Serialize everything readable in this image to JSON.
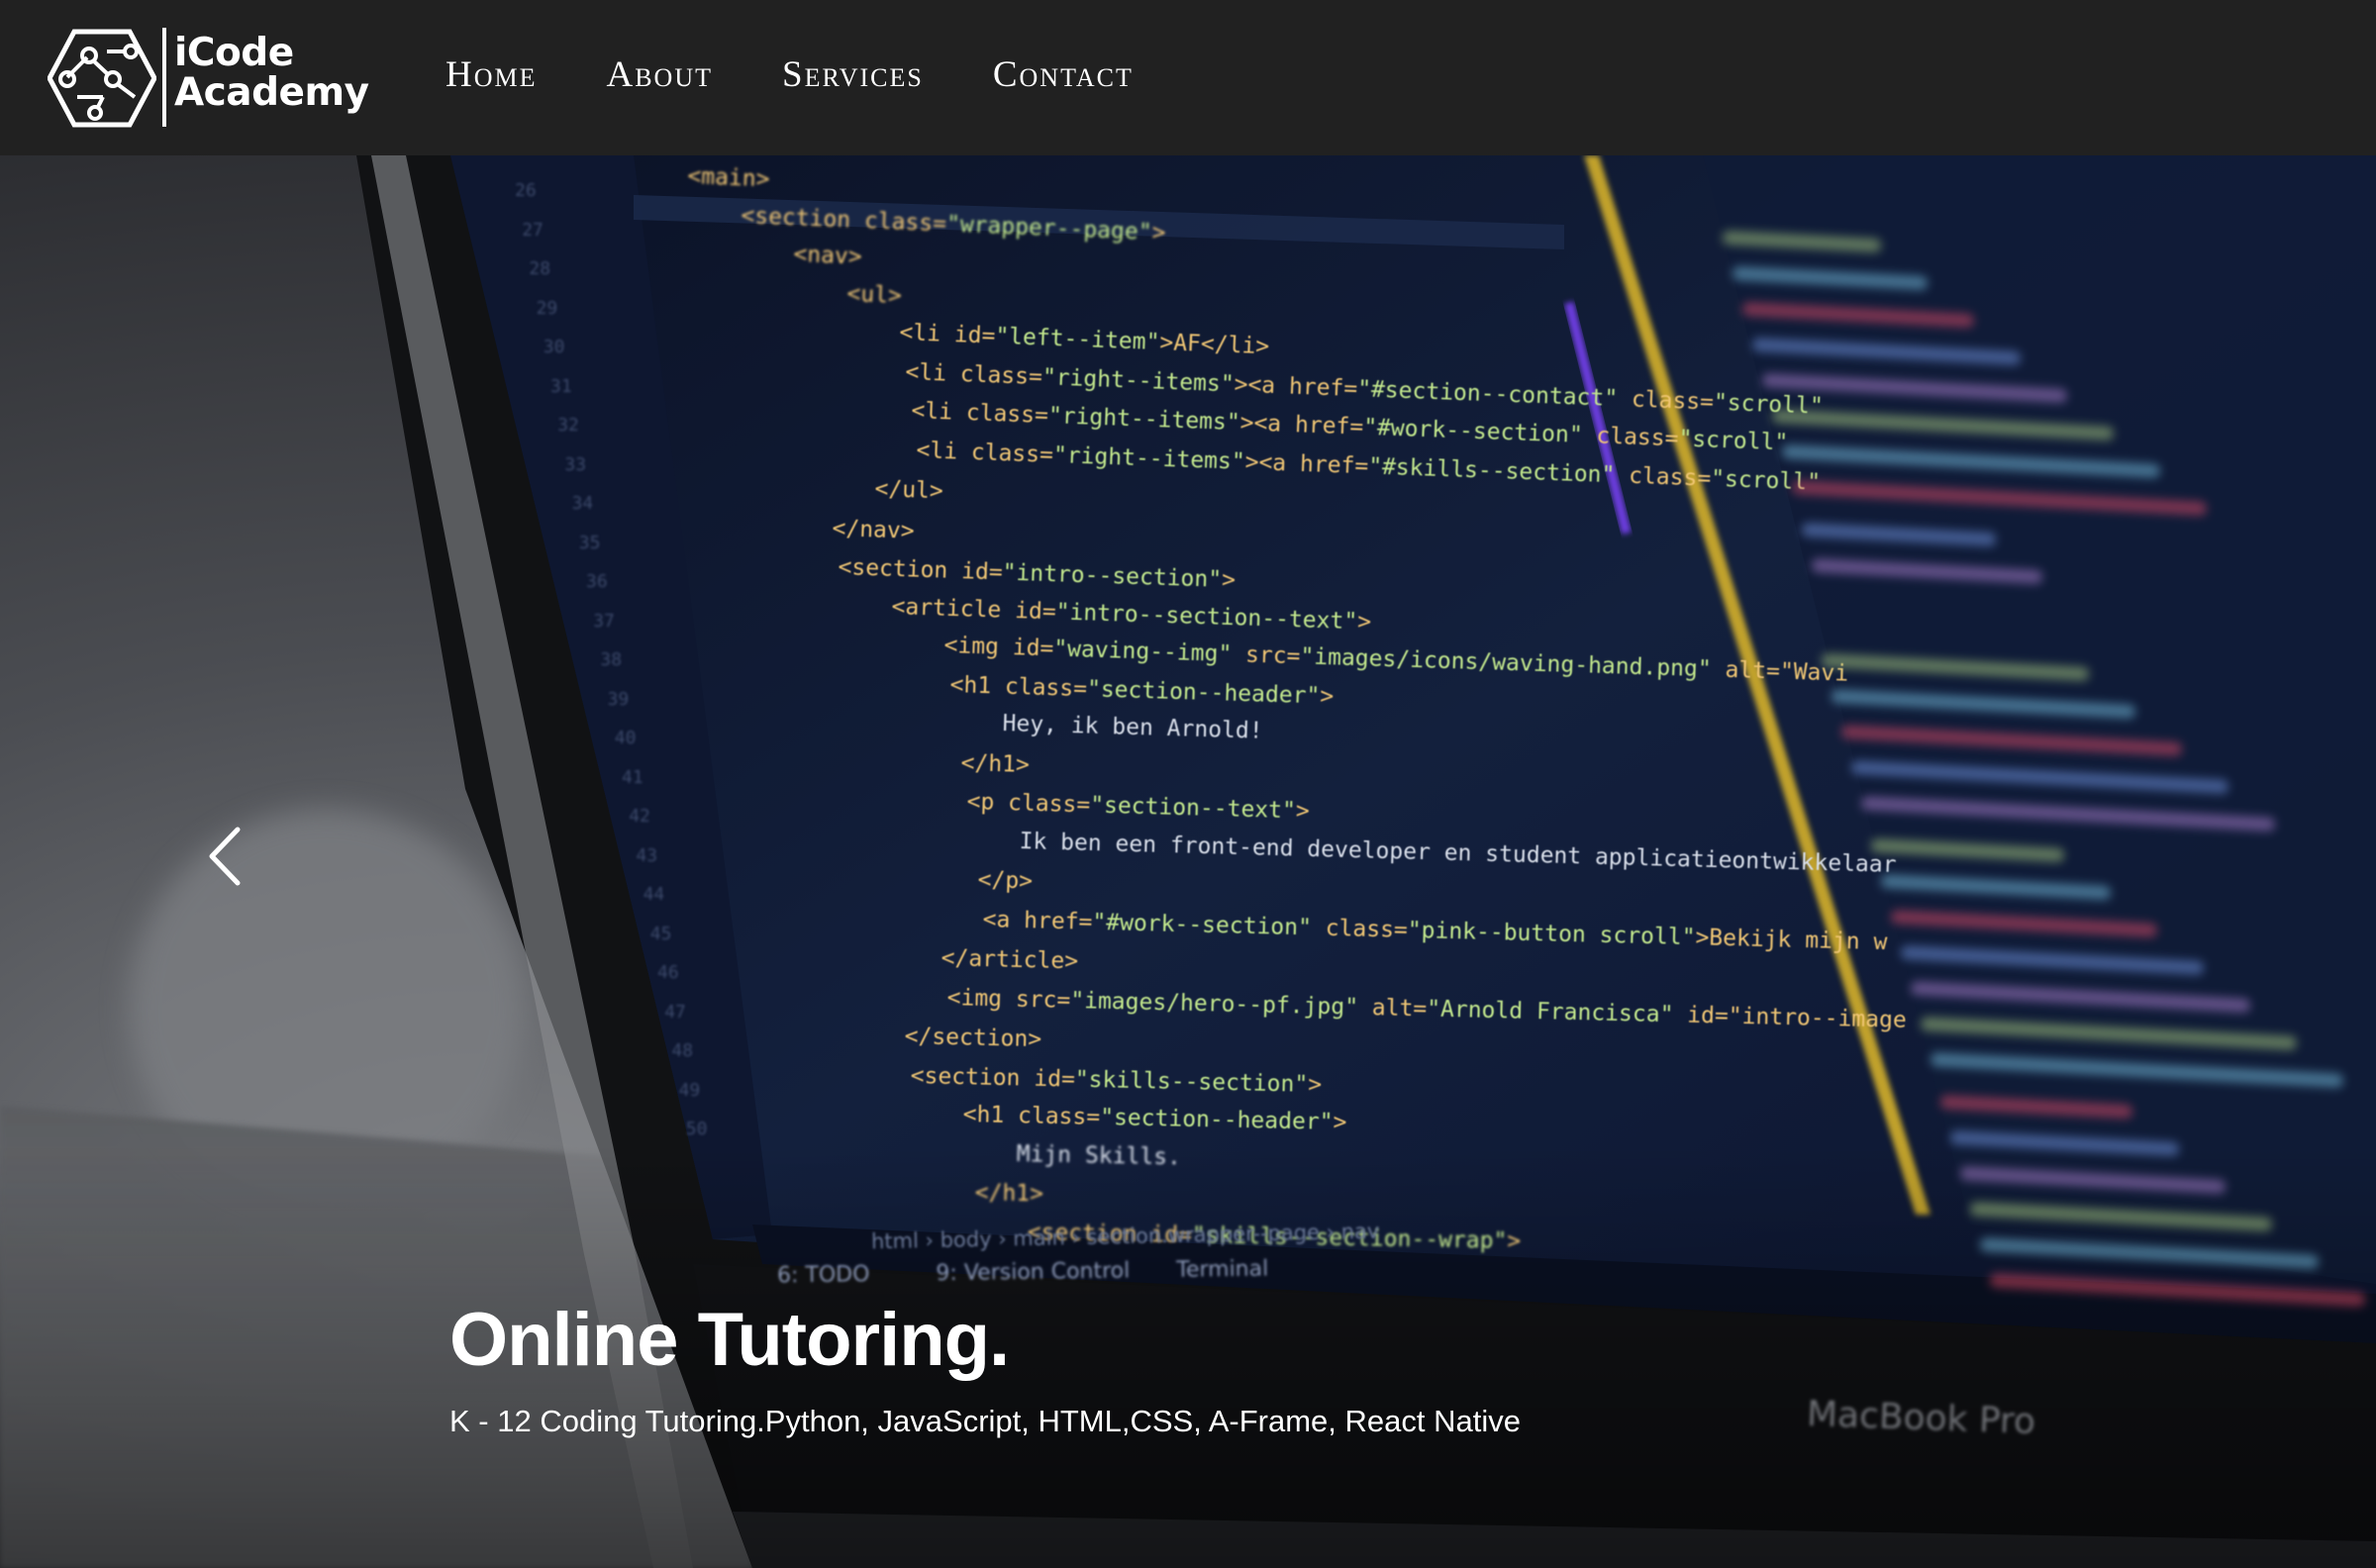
{
  "brand": {
    "name_line1": "iCode",
    "name_line2": "Academy",
    "logo_icon": "circuit-hexagon-icon"
  },
  "nav": {
    "items": [
      {
        "label": "Home"
      },
      {
        "label": "About"
      },
      {
        "label": "Services"
      },
      {
        "label": "Contact"
      }
    ]
  },
  "hero": {
    "title": "Online Tutoring.",
    "subtitle": "K - 12 Coding Tutoring.Python, JavaScript, HTML,CSS, A-Frame, React Native",
    "prev_icon": "chevron-left-icon",
    "laptop_label": "MacBook Pro",
    "editor_tabs": [
      "6: TODO",
      "9: Version Control",
      "Terminal"
    ],
    "breadcrumb": [
      "html",
      "body",
      "main",
      "section.wrapper--page",
      "nav"
    ],
    "code_lines": [
      "<main>",
      "<section class=\"wrapper--page\">",
      "<nav>",
      "<ul>",
      "<li id=\"left--item\">AF</li>",
      "<li class=\"right--items\"><a href=\"#section--contact\" class=\"scroll\"",
      "<li class=\"right--items\"><a href=\"#work--section\" class=\"scroll\"",
      "<li class=\"right--items\"><a href=\"#skills--section\" class=\"scroll\"",
      "</ul>",
      "</nav>",
      "<section id=\"intro--section\">",
      "<article id=\"intro--section--text\">",
      "<img id=\"waving--img\" src=\"images/icons/waving-hand.png\" alt=\"Wavi",
      "<h1 class=\"section--header\">",
      "Hey, ik ben Arnold!",
      "</h1>",
      "<p class=\"section--text\">",
      "Ik ben een front-end developer en student applicatieontwikkelaar",
      "</p>",
      "<a href=\"#work--section\" class=\"pink--button scroll\">Bekijk mijn w",
      "</article>",
      "<img src=\"images/hero--pf.jpg\" alt=\"Arnold Francisca\" id=\"intro--image",
      "</section>",
      "<section id=\"skills--section\">",
      "<h1 class=\"section--header\">",
      "Mijn Skills.",
      "</h1>",
      "<section id=\"skills--section--wrap\">"
    ],
    "line_numbers": [
      "26",
      "27",
      "28",
      "29",
      "30",
      "31",
      "32",
      "33",
      "34",
      "35",
      "36",
      "37",
      "38",
      "39",
      "40",
      "41",
      "42",
      "43",
      "44",
      "45",
      "46",
      "47",
      "48",
      "49",
      "50"
    ]
  },
  "colors": {
    "navbar_bg": "#212121",
    "screen_bg": "#0f1a33",
    "tag_color": "#f0c674",
    "attr_color": "#e6c07b",
    "string_color": "#c3e88d",
    "text_color": "#d8dee9"
  }
}
